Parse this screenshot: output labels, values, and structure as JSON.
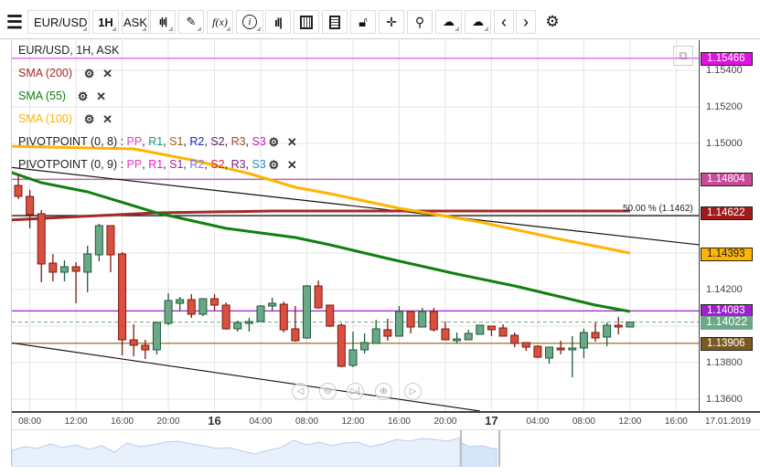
{
  "toolbar": {
    "menu_icon": "hamburger-icon",
    "symbol": "EUR/USD",
    "timeframe": "1H",
    "price_type": "ASK",
    "icons": [
      "candlestick-icon",
      "pencil-icon",
      "function-icon",
      "info-icon",
      "bar-chart-icon",
      "calendar-icon",
      "report-icon",
      "lock-icon",
      "crosshair-icon",
      "zoom-icon",
      "cloud-upload-icon",
      "cloud-download-icon",
      "chevron-left-icon",
      "chevron-right-icon",
      "gear-icon"
    ],
    "fx_label": "f(x)",
    "info_label": "i"
  },
  "legend": {
    "title": "EUR/USD, 1H, ASK",
    "indicators": [
      {
        "label": "SMA (200)",
        "color": "#a52a2a"
      },
      {
        "label": "SMA (55)",
        "color": "#108010"
      },
      {
        "label": "SMA (100)",
        "color": "#ffb400"
      }
    ],
    "pivots": [
      {
        "label": "PIVOTPOINT (0, 8)",
        "sep": " : ",
        "parts": [
          {
            "t": "PP",
            "c": "#e040c0"
          },
          {
            "t": "R1",
            "c": "#10a070"
          },
          {
            "t": "S1",
            "c": "#a06020"
          },
          {
            "t": "R2",
            "c": "#1030a0"
          },
          {
            "t": "S2",
            "c": "#602060"
          },
          {
            "t": "R3",
            "c": "#a05020"
          },
          {
            "t": "S3",
            "c": "#c020c0"
          }
        ]
      },
      {
        "label": "PIVOTPOINT (0, 9)",
        "sep": " : ",
        "parts": [
          {
            "t": "PP",
            "c": "#e040c0"
          },
          {
            "t": "R1",
            "c": "#ff10d0"
          },
          {
            "t": "S1",
            "c": "#a020a0"
          },
          {
            "t": "R2",
            "c": "#8070e0"
          },
          {
            "t": "S2",
            "c": "#c02050"
          },
          {
            "t": "R3",
            "c": "#802080"
          },
          {
            "t": "S3",
            "c": "#2090c0"
          }
        ]
      }
    ]
  },
  "price_axis": {
    "labels": [
      "1.15400",
      "1.15200",
      "1.15000",
      "1.14200",
      "1.13800",
      "1.13600"
    ],
    "values": [
      1.154,
      1.152,
      1.15,
      1.142,
      1.138,
      1.136
    ],
    "grid": [
      1.154,
      1.152,
      1.15,
      1.148,
      1.146,
      1.144,
      1.142,
      1.14,
      1.138,
      1.136
    ]
  },
  "levels": [
    {
      "label": "1.15466",
      "value": 1.15466,
      "color": "#e010e0",
      "line": "#e040e0",
      "text": "#fff"
    },
    {
      "label": "1.14804",
      "value": 1.14804,
      "color": "#c84a9a",
      "line": "#b0409a",
      "text": "#fff"
    },
    {
      "label": "1.14622",
      "value": 1.14622,
      "color": "#a01c1c",
      "line": null,
      "text": "#fff"
    },
    {
      "label": "1.14393",
      "value": 1.14393,
      "color": "#ffb400",
      "line": null,
      "text": "#222"
    },
    {
      "label": "1.14083",
      "value": 1.14083,
      "color": "#a020d0",
      "line": "#a020d0",
      "text": "#fff"
    },
    {
      "label": "1.14022",
      "value": 1.14022,
      "color": "#6aa888",
      "line": "dashed",
      "text": "#fff"
    },
    {
      "label": "1.13906",
      "value": 1.13906,
      "color": "#7a5a20",
      "line": "#8a6010",
      "text": "#fff"
    }
  ],
  "fib_label": "50.00 % (1.1462)",
  "fib_value": 1.1462,
  "time_axis": {
    "labels": [
      {
        "t": "08:00",
        "h": 1
      },
      {
        "t": "12:00",
        "h": 5
      },
      {
        "t": "16:00",
        "h": 9
      },
      {
        "t": "20:00",
        "h": 13
      },
      {
        "t": "16",
        "h": 17,
        "big": true
      },
      {
        "t": "04:00",
        "h": 21
      },
      {
        "t": "08:00",
        "h": 25
      },
      {
        "t": "12:00",
        "h": 29
      },
      {
        "t": "16:00",
        "h": 33
      },
      {
        "t": "20:00",
        "h": 37
      },
      {
        "t": "17",
        "h": 41,
        "big": true
      },
      {
        "t": "04:00",
        "h": 45
      },
      {
        "t": "08:00",
        "h": 49
      },
      {
        "t": "12:00",
        "h": 53
      },
      {
        "t": "16:00",
        "h": 57
      }
    ],
    "date": "17.01.2019"
  },
  "chart_data": {
    "type": "candlestick",
    "symbol": "EUR/USD",
    "interval": "1H",
    "ylim": [
      1.1355,
      1.1556
    ],
    "ohlc": [
      [
        1.1477,
        1.1483,
        1.14695,
        1.1471
      ],
      [
        1.1471,
        1.14745,
        1.14535,
        1.1461
      ],
      [
        1.14615,
        1.14635,
        1.1424,
        1.1434
      ],
      [
        1.14345,
        1.14395,
        1.14245,
        1.14295
      ],
      [
        1.14295,
        1.1436,
        1.14245,
        1.14325
      ],
      [
        1.14325,
        1.1435,
        1.14125,
        1.143
      ],
      [
        1.14295,
        1.1444,
        1.14185,
        1.14395
      ],
      [
        1.1439,
        1.1456,
        1.14355,
        1.1455
      ],
      [
        1.1455,
        1.1455,
        1.14295,
        1.1439
      ],
      [
        1.14395,
        1.14405,
        1.1384,
        1.13925
      ],
      [
        1.13925,
        1.1401,
        1.13835,
        1.13895
      ],
      [
        1.13895,
        1.13925,
        1.1382,
        1.1387
      ],
      [
        1.1387,
        1.14025,
        1.13845,
        1.1402
      ],
      [
        1.14015,
        1.1418,
        1.14005,
        1.1414
      ],
      [
        1.14125,
        1.1416,
        1.14085,
        1.14145
      ],
      [
        1.14145,
        1.14175,
        1.14045,
        1.14065
      ],
      [
        1.14065,
        1.1415,
        1.14055,
        1.1415
      ],
      [
        1.1415,
        1.14175,
        1.14085,
        1.14115
      ],
      [
        1.14115,
        1.1413,
        1.1398,
        1.13985
      ],
      [
        1.13985,
        1.1403,
        1.1397,
        1.1402
      ],
      [
        1.14015,
        1.14045,
        1.1397,
        1.14025
      ],
      [
        1.14025,
        1.14115,
        1.14025,
        1.1411
      ],
      [
        1.1411,
        1.14155,
        1.14085,
        1.14125
      ],
      [
        1.1412,
        1.14135,
        1.13965,
        1.1398
      ],
      [
        1.13985,
        1.1411,
        1.13915,
        1.1392
      ],
      [
        1.13935,
        1.14225,
        1.1393,
        1.1422
      ],
      [
        1.1422,
        1.1425,
        1.14095,
        1.141
      ],
      [
        1.14115,
        1.14115,
        1.13995,
        1.14
      ],
      [
        1.14005,
        1.14015,
        1.13775,
        1.1378
      ],
      [
        1.13785,
        1.1397,
        1.13775,
        1.1387
      ],
      [
        1.1387,
        1.1396,
        1.1385,
        1.1391
      ],
      [
        1.13905,
        1.14035,
        1.13905,
        1.13985
      ],
      [
        1.1398,
        1.1404,
        1.1392,
        1.13945
      ],
      [
        1.13945,
        1.1411,
        1.13945,
        1.1408
      ],
      [
        1.1408,
        1.1408,
        1.1396,
        1.13995
      ],
      [
        1.13995,
        1.141,
        1.13995,
        1.1408
      ],
      [
        1.1408,
        1.141,
        1.1397,
        1.1398
      ],
      [
        1.13985,
        1.14025,
        1.13925,
        1.13925
      ],
      [
        1.13925,
        1.13965,
        1.13905,
        1.1393
      ],
      [
        1.13925,
        1.1398,
        1.13925,
        1.1396
      ],
      [
        1.13955,
        1.14005,
        1.13955,
        1.14005
      ],
      [
        1.14,
        1.14,
        1.13945,
        1.1398
      ],
      [
        1.1399,
        1.1401,
        1.13945,
        1.13945
      ],
      [
        1.1395,
        1.13965,
        1.13885,
        1.13905
      ],
      [
        1.1391,
        1.1391,
        1.13865,
        1.13885
      ],
      [
        1.1389,
        1.13895,
        1.13825,
        1.1383
      ],
      [
        1.13825,
        1.13885,
        1.13795,
        1.13885
      ],
      [
        1.1388,
        1.1392,
        1.13845,
        1.13875
      ],
      [
        1.13875,
        1.13945,
        1.1372,
        1.1388
      ],
      [
        1.1388,
        1.13985,
        1.13825,
        1.13965
      ],
      [
        1.13965,
        1.1402,
        1.13915,
        1.13935
      ],
      [
        1.1394,
        1.1402,
        1.1389,
        1.14005
      ],
      [
        1.14005,
        1.1405,
        1.13955,
        1.13995
      ],
      [
        1.13995,
        1.14022,
        1.13995,
        1.14022
      ]
    ],
    "series": [
      {
        "name": "SMA (200)",
        "color": "#a52a2a",
        "points": [
          [
            -1,
            1.1458
          ],
          [
            7,
            1.14605
          ],
          [
            12,
            1.1462
          ],
          [
            22,
            1.1463
          ],
          [
            53,
            1.1463
          ]
        ]
      },
      {
        "name": "SMA (55)",
        "color": "#108010",
        "points": [
          [
            -1,
            1.1485
          ],
          [
            2,
            1.14785
          ],
          [
            6,
            1.14735
          ],
          [
            12,
            1.1462
          ],
          [
            18,
            1.14535
          ],
          [
            24,
            1.14485
          ],
          [
            27,
            1.14445
          ],
          [
            32,
            1.1437
          ],
          [
            38,
            1.14285
          ],
          [
            43,
            1.1422
          ],
          [
            47,
            1.1416
          ],
          [
            50,
            1.14115
          ],
          [
            53,
            1.1408
          ]
        ]
      },
      {
        "name": "SMA (100)",
        "color": "#ffb400",
        "points": [
          [
            -1,
            1.14985
          ],
          [
            10,
            1.1497
          ],
          [
            15,
            1.1491
          ],
          [
            20,
            1.14835
          ],
          [
            24,
            1.1476
          ],
          [
            27,
            1.14725
          ],
          [
            33,
            1.14645
          ],
          [
            40,
            1.1457
          ],
          [
            47,
            1.14475
          ],
          [
            53,
            1.144
          ]
        ]
      }
    ],
    "trendlines": [
      {
        "from": [
          -0.8,
          1.1487
        ],
        "to": [
          59,
          1.14445
        ]
      },
      {
        "from": [
          -0.8,
          1.1391
        ],
        "to": [
          40,
          1.13535
        ]
      }
    ],
    "up_color": "#6aa888",
    "down_color": "#d95040"
  }
}
